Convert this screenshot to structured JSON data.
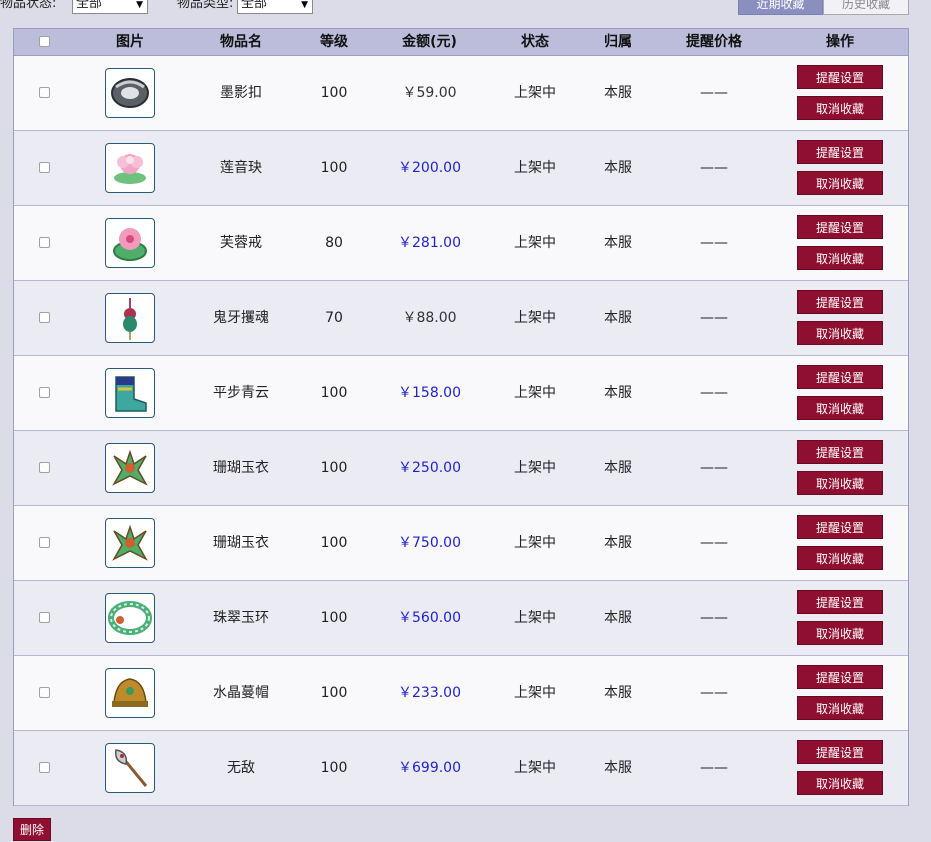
{
  "filters": {
    "status_label": "物品状态:",
    "status_value": "全部",
    "type_label": "物品类型:",
    "type_value": "全部"
  },
  "tabs": [
    {
      "label": "近期收藏",
      "active": true
    },
    {
      "label": "历史收藏",
      "active": false
    }
  ],
  "columns": [
    "图片",
    "物品名",
    "等级",
    "金额(元)",
    "状态",
    "归属",
    "提醒价格",
    "操作"
  ],
  "actions": {
    "remind": "提醒设置",
    "unfav": "取消收藏"
  },
  "rows": [
    {
      "name": "墨影扣",
      "level": "100",
      "price": "￥59.00",
      "price_color": "plain",
      "status": "上架中",
      "owner": "本服",
      "remind_price": "——",
      "icon": "black-ring-icon"
    },
    {
      "name": "莲音玦",
      "level": "100",
      "price": "￥200.00",
      "price_color": "blue",
      "status": "上架中",
      "owner": "本服",
      "remind_price": "——",
      "icon": "lotus-pendant-icon"
    },
    {
      "name": "芙蓉戒",
      "level": "80",
      "price": "￥281.00",
      "price_color": "blue",
      "status": "上架中",
      "owner": "本服",
      "remind_price": "——",
      "icon": "flower-ring-icon"
    },
    {
      "name": "鬼牙攫魂",
      "level": "70",
      "price": "￥88.00",
      "price_color": "plain",
      "status": "上架中",
      "owner": "本服",
      "remind_price": "——",
      "icon": "amulet-icon"
    },
    {
      "name": "平步青云",
      "level": "100",
      "price": "￥158.00",
      "price_color": "blue",
      "status": "上架中",
      "owner": "本服",
      "remind_price": "——",
      "icon": "boots-icon"
    },
    {
      "name": "珊瑚玉衣",
      "level": "100",
      "price": "￥250.00",
      "price_color": "blue",
      "status": "上架中",
      "owner": "本服",
      "remind_price": "——",
      "icon": "armor-icon"
    },
    {
      "name": "珊瑚玉衣",
      "level": "100",
      "price": "￥750.00",
      "price_color": "blue",
      "status": "上架中",
      "owner": "本服",
      "remind_price": "——",
      "icon": "armor-icon"
    },
    {
      "name": "珠翠玉环",
      "level": "100",
      "price": "￥560.00",
      "price_color": "blue",
      "status": "上架中",
      "owner": "本服",
      "remind_price": "——",
      "icon": "jade-belt-icon"
    },
    {
      "name": "水晶蔓帽",
      "level": "100",
      "price": "￥233.00",
      "price_color": "blue",
      "status": "上架中",
      "owner": "本服",
      "remind_price": "——",
      "icon": "helmet-icon"
    },
    {
      "name": "无敌",
      "level": "100",
      "price": "￥699.00",
      "price_color": "blue",
      "status": "上架中",
      "owner": "本服",
      "remind_price": "——",
      "icon": "axe-icon"
    }
  ],
  "footer": {
    "delete_label": "删除"
  },
  "colors": {
    "accent": "#8e0f2f",
    "header_bg": "#bbbdda",
    "price_blue": "#2222cc"
  }
}
